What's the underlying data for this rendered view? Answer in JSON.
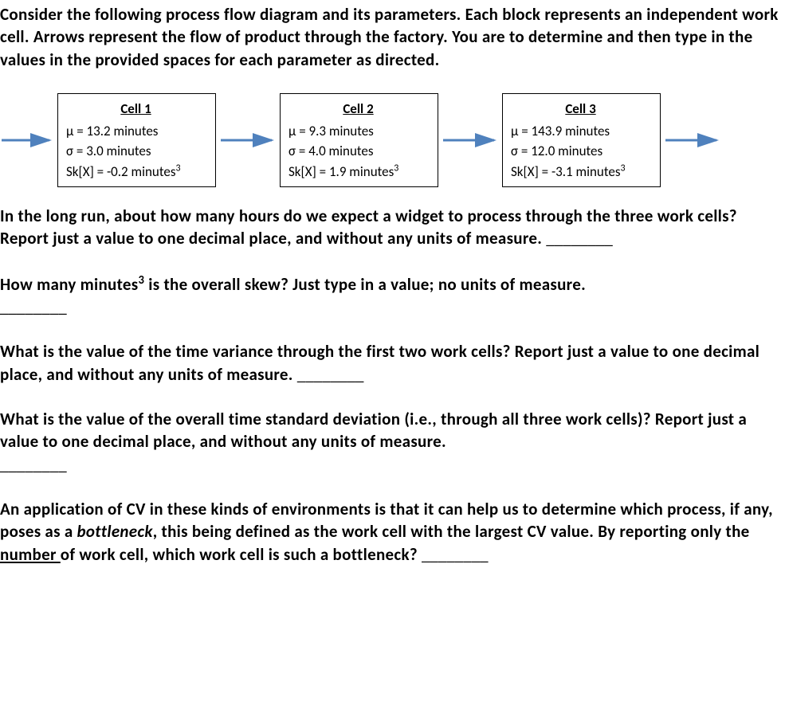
{
  "intro": "Consider the following process flow diagram and its parameters.  Each block represents an independent work cell.  Arrows represent the flow of product through the factory.  You are to determine and then type in the values in the provided spaces for each parameter as directed.",
  "cells": [
    {
      "title": "Cell 1",
      "mu": "μ = 13.2 minutes",
      "sigma": "σ = 3.0 minutes",
      "skew_prefix": "Sk[X] = -0.2 minutes",
      "skew_exp": "3"
    },
    {
      "title": "Cell 2",
      "mu": "μ = 9.3 minutes",
      "sigma": "σ = 4.0 minutes",
      "skew_prefix": "Sk[X] = 1.9 minutes",
      "skew_exp": "3"
    },
    {
      "title": "Cell 3",
      "mu": "μ = 143.9 minutes",
      "sigma": "σ = 12.0 minutes",
      "skew_prefix": "Sk[X] = -3.1 minutes",
      "skew_exp": "3"
    }
  ],
  "q1": {
    "text": "In the long run, about how many hours do we expect a widget to process through the three work cells?  Report just a value to one decimal place, and without any units of measure. ",
    "blank": "________"
  },
  "q2": {
    "prefix": "How many minutes",
    "exp": "3",
    "suffix": " is the overall skew?  Just type in a value; no units of measure. ",
    "blank": "________"
  },
  "q3": {
    "text": "What is the value of the time variance through the first two work cells?  Report just a value to one decimal place, and without any units of measure. ",
    "blank": "________"
  },
  "q4": {
    "text": "What is the value of the overall time standard deviation (i.e., through all three work cells)?  Report just a value to one decimal place, and without any units of measure. ",
    "blank": "________"
  },
  "q5": {
    "part1": "An application of CV in these kinds of environments is that it can help us to determine which process, if any, poses as a ",
    "italic": "bottleneck",
    "part2": ", this being defined as the work cell with the largest CV value.  By reporting only the ",
    "underline": "number ",
    "part3": "of work cell, which work cell is such a bottleneck? ",
    "blank": "________"
  }
}
